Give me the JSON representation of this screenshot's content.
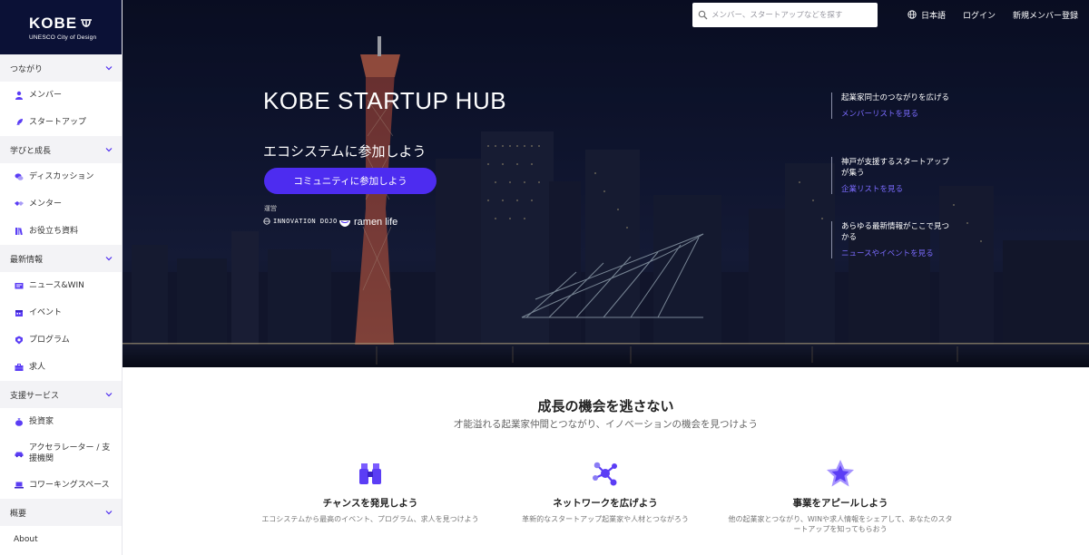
{
  "logo": {
    "main": "KOBE",
    "sub": "UNESCO City of Design"
  },
  "sidebar": {
    "sections": [
      {
        "label": "つながり",
        "items": [
          {
            "label": "メンバー",
            "icon": "person-icon"
          },
          {
            "label": "スタートアップ",
            "icon": "rocket-icon"
          }
        ]
      },
      {
        "label": "学びと成長",
        "items": [
          {
            "label": "ディスカッション",
            "icon": "chat-icon"
          },
          {
            "label": "メンター",
            "icon": "handshake-icon"
          },
          {
            "label": "お役立ち資料",
            "icon": "books-icon"
          }
        ]
      },
      {
        "label": "最新情報",
        "items": [
          {
            "label": "ニュース&WIN",
            "icon": "news-icon"
          },
          {
            "label": "イベント",
            "icon": "calendar-icon"
          },
          {
            "label": "プログラム",
            "icon": "badge-icon"
          },
          {
            "label": "求人",
            "icon": "briefcase-icon"
          }
        ]
      },
      {
        "label": "支援サービス",
        "items": [
          {
            "label": "投資家",
            "icon": "moneybag-icon"
          },
          {
            "label": "アクセラレーター / 支援機関",
            "icon": "car-icon"
          },
          {
            "label": "コワーキングスペース",
            "icon": "laptop-icon"
          }
        ]
      },
      {
        "label": "概要",
        "items": []
      }
    ],
    "about": "About"
  },
  "header": {
    "search_placeholder": "メンバー、スタートアップなどを探す",
    "language": "日本語",
    "login": "ログイン",
    "register": "新規メンバー登録"
  },
  "hero": {
    "title": "KOBE STARTUP HUB",
    "subtitle": "エコシステムに参加しよう",
    "cta": "コミュニティに参加しよう",
    "operator_label": "運営",
    "partner1": "INNOVATION DOJO",
    "partner2": "ramen life",
    "cards": [
      {
        "text": "起業家同士のつながりを広げる",
        "link": "メンバーリストを見る"
      },
      {
        "text": "神戸が支援するスタートアップが集う",
        "link": "企業リストを見る"
      },
      {
        "text": "あらゆる最新情報がここで見つかる",
        "link": "ニュースやイベントを見る"
      }
    ]
  },
  "lower": {
    "heading": "成長の機会を逃さない",
    "subheading": "才能溢れる起業家仲間とつながり、イノベーションの機会を見つけよう",
    "features": [
      {
        "title": "チャンスを発見しよう",
        "desc": "エコシステムから最高のイベント、プログラム、求人を見つけよう",
        "icon": "binoculars-icon"
      },
      {
        "title": "ネットワークを広げよう",
        "desc": "革新的なスタートアップ起業家や人材とつながろう",
        "icon": "network-icon"
      },
      {
        "title": "事業をアピールしよう",
        "desc": "他の起業家とつながり、WINや求人情報をシェアして、あなたのスタートアップを知ってもらおう",
        "icon": "star-icon"
      }
    ]
  },
  "colors": {
    "accent": "#4d2cf0",
    "link": "#7b6bff",
    "sidebar_dark": "#0b1136",
    "icon": "#5b3df5"
  }
}
